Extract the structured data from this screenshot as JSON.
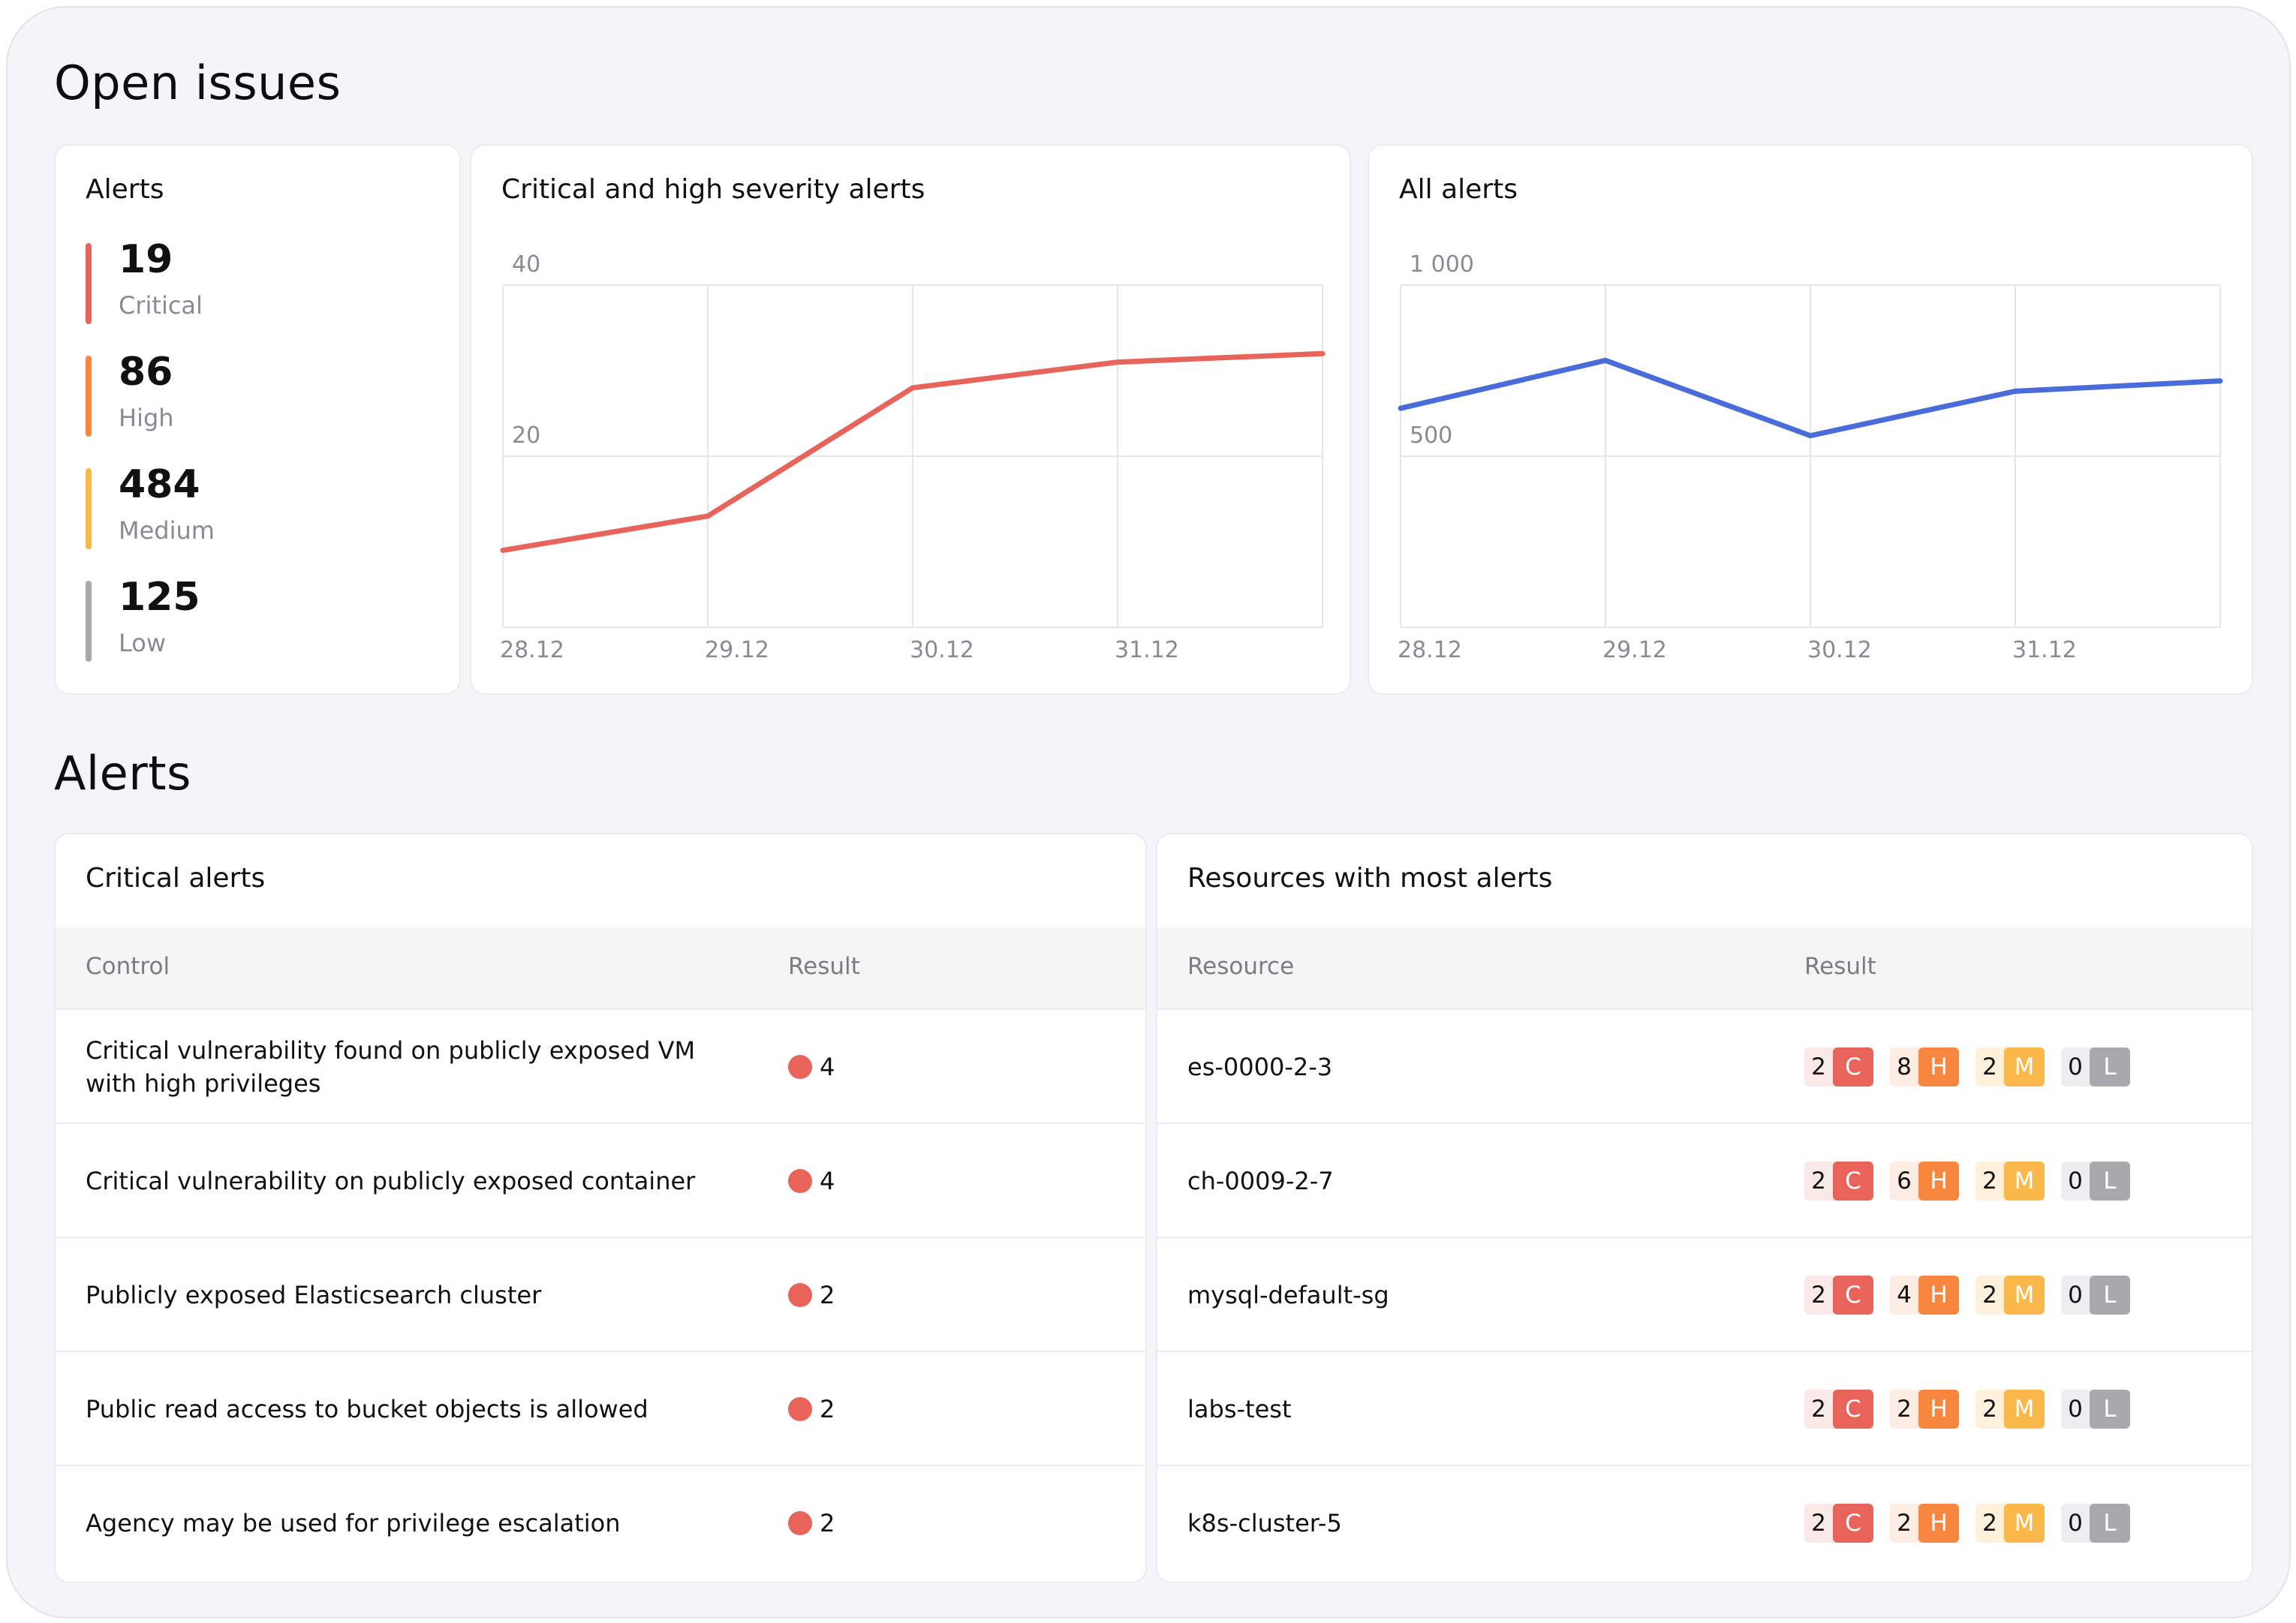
{
  "sections": {
    "open_issues_title": "Open issues",
    "alerts_title": "Alerts"
  },
  "summary": {
    "title": "Alerts",
    "items": [
      {
        "count": "19",
        "label": "Critical",
        "color": "#e8635a"
      },
      {
        "count": "86",
        "label": "High",
        "color": "#f7873f"
      },
      {
        "count": "484",
        "label": "Medium",
        "color": "#fbb84a"
      },
      {
        "count": "125",
        "label": "Low",
        "color": "#a8a8ad"
      }
    ]
  },
  "chart_data": [
    {
      "type": "line",
      "title": "Critical and high severity alerts",
      "x": [
        "28.12",
        "29.12",
        "30.12",
        "31.12",
        ""
      ],
      "series": [
        {
          "values": [
            9,
            13,
            28,
            31,
            32
          ],
          "color": "#e8635a"
        }
      ],
      "yticks": [
        {
          "value": 20,
          "label": "20"
        },
        {
          "value": 40,
          "label": "40"
        }
      ],
      "ylim": [
        0,
        40
      ],
      "grid": true
    },
    {
      "type": "line",
      "title": "All alerts",
      "x": [
        "28.12",
        "29.12",
        "30.12",
        "31.12",
        ""
      ],
      "series": [
        {
          "values": [
            640,
            780,
            560,
            690,
            720
          ],
          "color": "#4a6cdb"
        }
      ],
      "yticks": [
        {
          "value": 500,
          "label": "500"
        },
        {
          "value": 1000,
          "label": "1 000"
        }
      ],
      "ylim": [
        0,
        1000
      ],
      "grid": true
    }
  ],
  "critical_alerts": {
    "title": "Critical alerts",
    "columns": [
      "Control",
      "Result"
    ],
    "rows": [
      {
        "control": "Critical vulnerability found on publicly exposed VM with high privileges",
        "result": "4"
      },
      {
        "control": "Critical vulnerability on publicly exposed container",
        "result": "4"
      },
      {
        "control": "Publicly exposed Elasticsearch cluster",
        "result": "2"
      },
      {
        "control": "Public read access to bucket objects is allowed",
        "result": "2"
      },
      {
        "control": "Agency may be used for privilege escalation",
        "result": "2"
      }
    ]
  },
  "resources": {
    "title": "Resources with most alerts",
    "columns": [
      "Resource",
      "Result"
    ],
    "severity_letters": [
      "C",
      "H",
      "M",
      "L"
    ],
    "severity_colors": {
      "C": {
        "bg": "#fbe9e7",
        "tag": "#e8635a"
      },
      "H": {
        "bg": "#fdece1",
        "tag": "#f7873f"
      },
      "M": {
        "bg": "#fdf1dc",
        "tag": "#fbb84a"
      },
      "L": {
        "bg": "#ededef",
        "tag": "#a8a8ad"
      }
    },
    "rows": [
      {
        "name": "es-0000-2-3",
        "counts": [
          "2",
          "8",
          "2",
          "0"
        ]
      },
      {
        "name": "ch-0009-2-7",
        "counts": [
          "2",
          "6",
          "2",
          "0"
        ]
      },
      {
        "name": "mysql-default-sg",
        "counts": [
          "2",
          "4",
          "2",
          "0"
        ]
      },
      {
        "name": "labs-test",
        "counts": [
          "2",
          "2",
          "2",
          "0"
        ]
      },
      {
        "name": "k8s-cluster-5",
        "counts": [
          "2",
          "2",
          "2",
          "0"
        ]
      }
    ]
  }
}
